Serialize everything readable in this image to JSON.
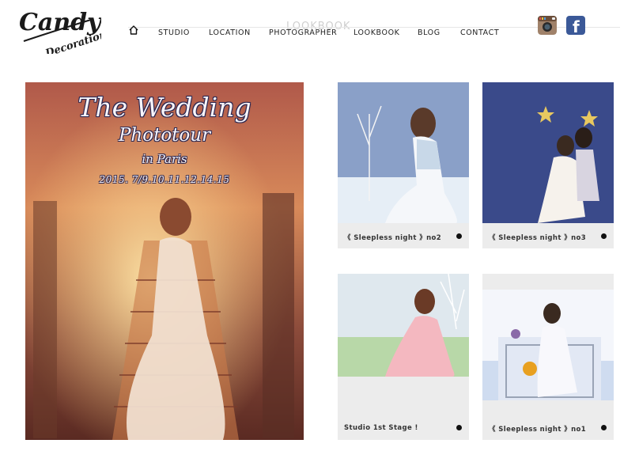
{
  "brand": {
    "logo_top": "Candy",
    "logo_bottom": "Decorations"
  },
  "header": {
    "page_title": "LOOKBOOK"
  },
  "nav": {
    "home_icon": "home-icon",
    "items": [
      {
        "label": "STUDIO"
      },
      {
        "label": "LOCATION"
      },
      {
        "label": "PHOTOGRAPHER"
      },
      {
        "label": "LOOKBOOK"
      },
      {
        "label": "BLOG"
      },
      {
        "label": "CONTACT"
      }
    ]
  },
  "social": {
    "instagram_icon": "instagram-icon",
    "facebook_icon": "facebook-icon",
    "facebook_glyph": "f"
  },
  "hero": {
    "title": "The Wedding",
    "subtitle": "Phototour",
    "place": "in Paris",
    "dates": "2015. 7/9.10.11.12.14.15"
  },
  "cards": [
    {
      "caption": "《 Sleepless night 》no2",
      "arrow_icon": "arrow-circle-icon"
    },
    {
      "caption": "《 Sleepless night 》no3",
      "arrow_icon": "arrow-circle-icon"
    },
    {
      "caption": "Studio 1st Stage !",
      "arrow_icon": "arrow-circle-icon"
    },
    {
      "caption": "《 Sleepless night 》no1",
      "arrow_icon": "arrow-circle-icon"
    }
  ],
  "colors": {
    "facebook": "#3b5998",
    "card_bg": "#ececec",
    "title_outline": "#2b2750"
  }
}
